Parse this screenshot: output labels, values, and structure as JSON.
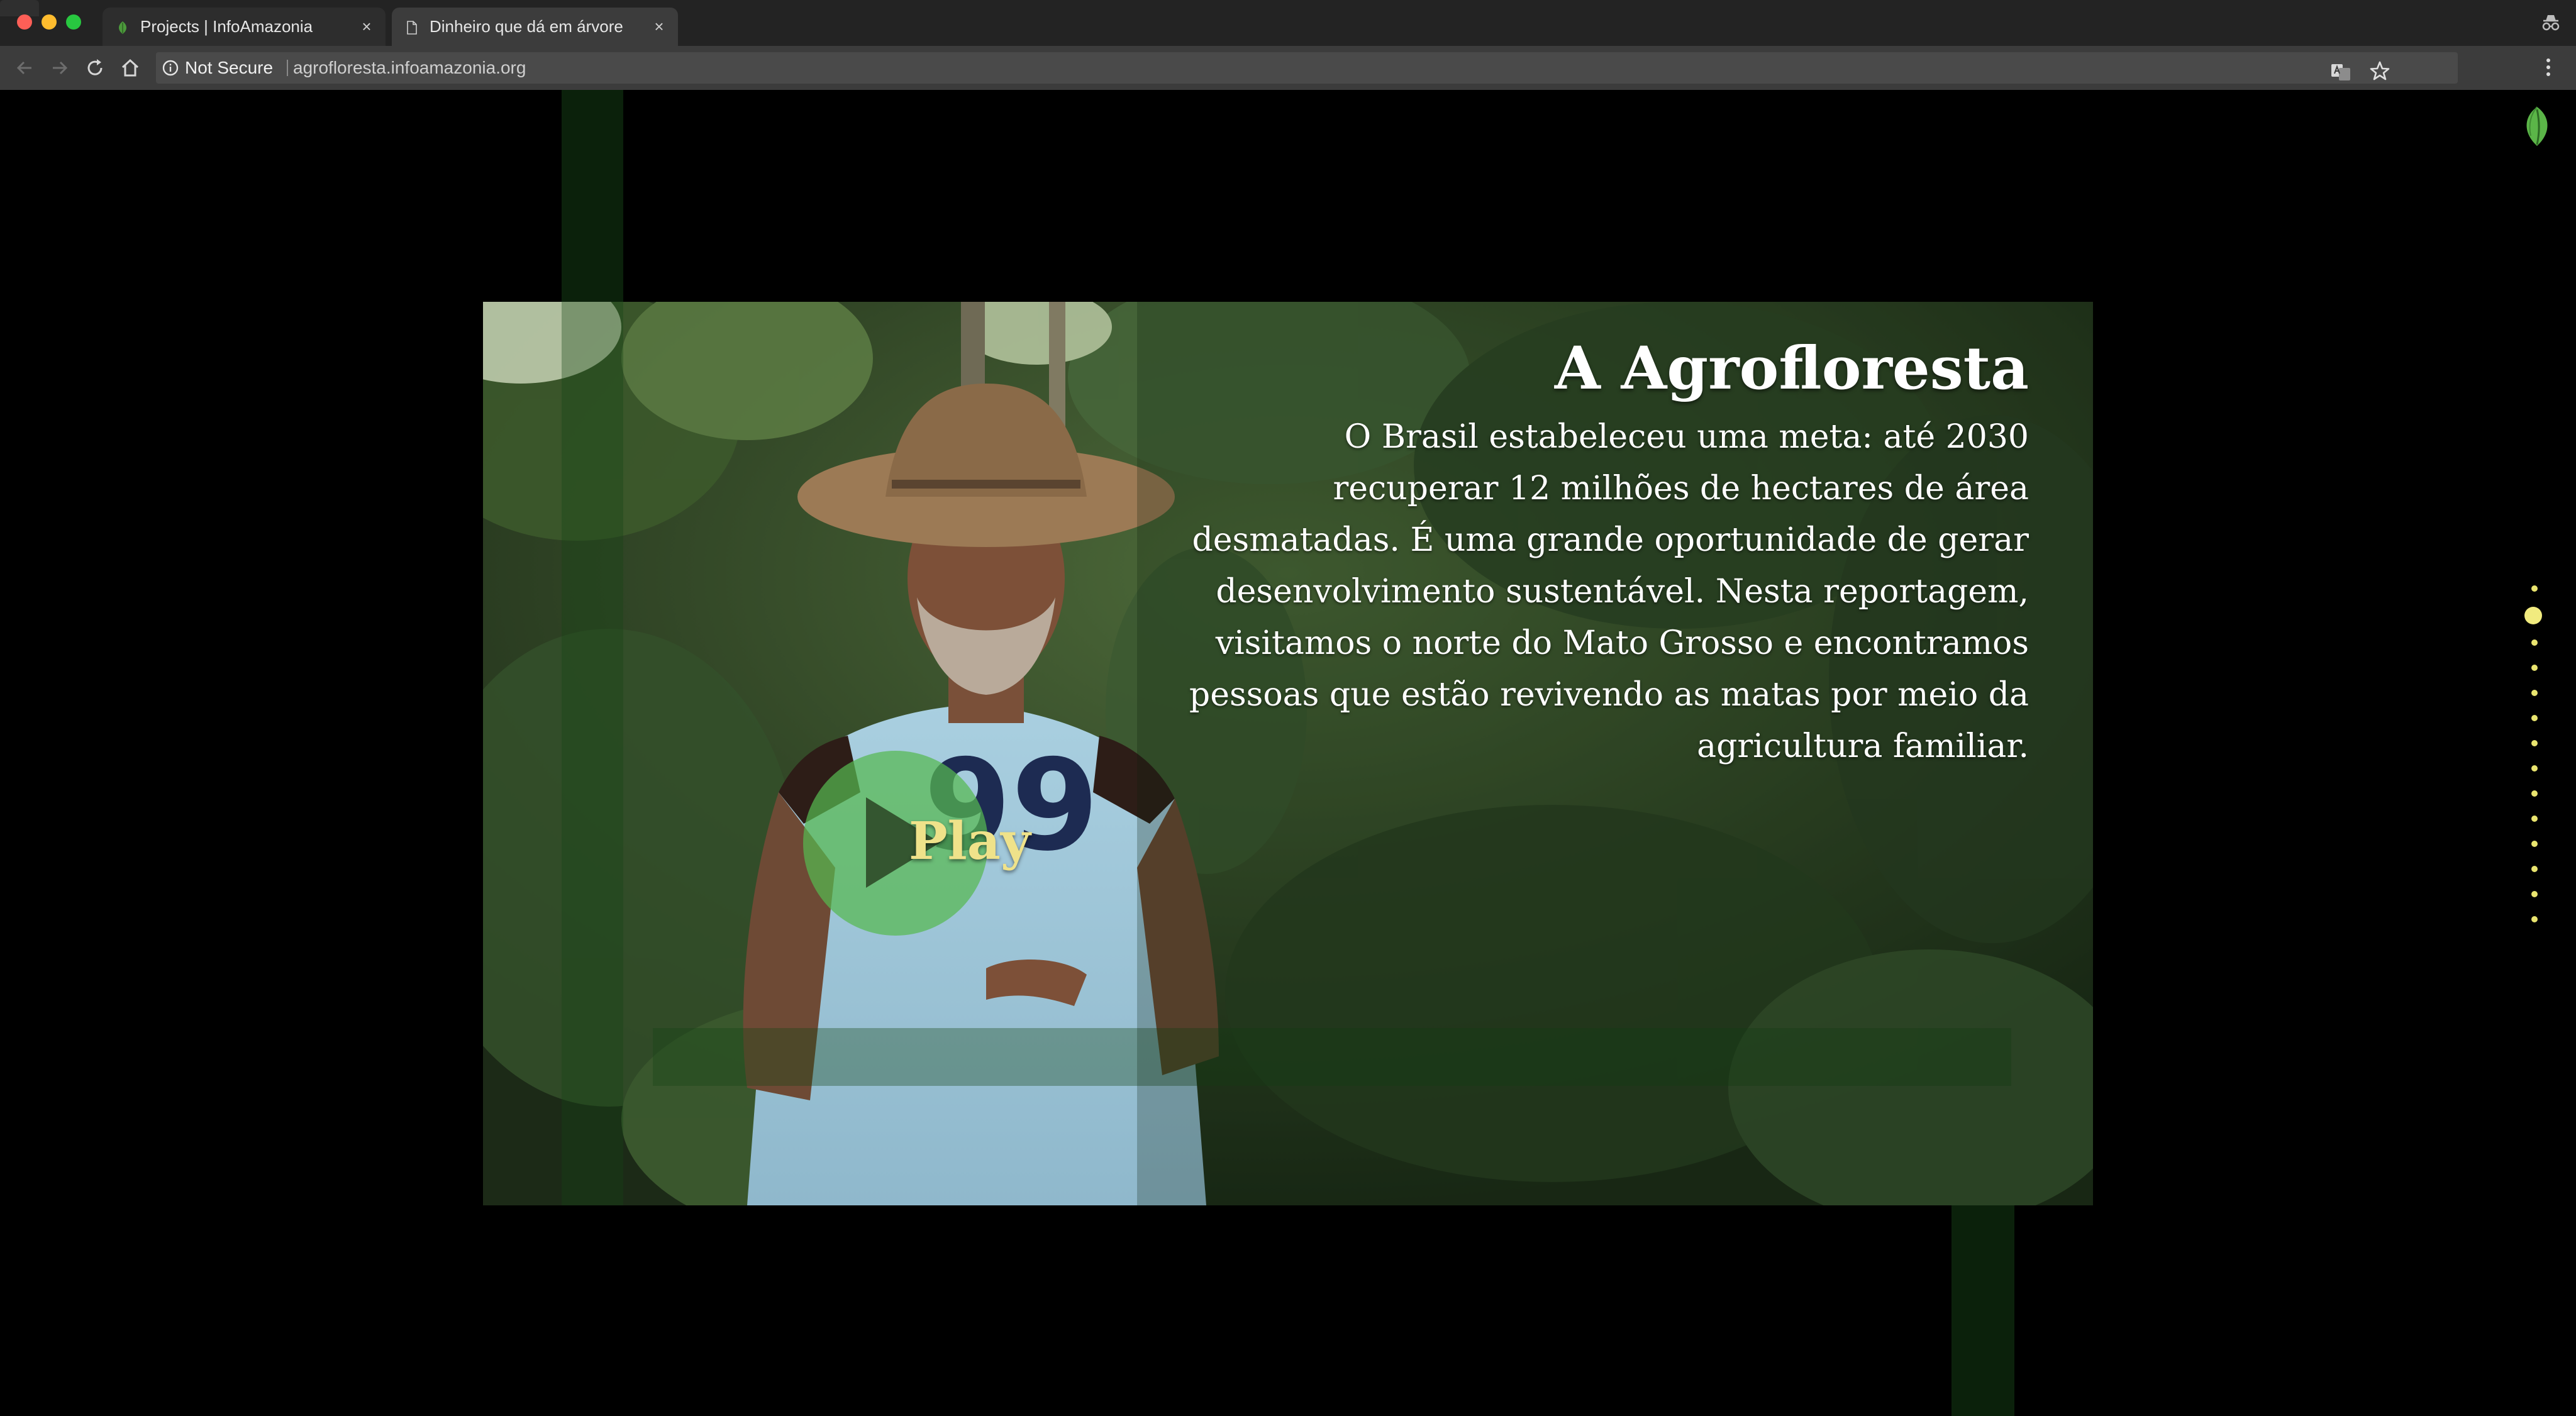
{
  "browser": {
    "tabs": [
      {
        "title": "Projects | InfoAmazonia",
        "icon": "leaf-favicon-icon",
        "active": false
      },
      {
        "title": "Dinheiro que dá em árvore",
        "icon": "page-icon",
        "active": true
      }
    ],
    "tab_close_glyph": "×",
    "security_label": "Not Secure",
    "url": "agrofloresta.infoamazonia.org"
  },
  "hero": {
    "title": "A Agrofloresta",
    "body": "O Brasil estabeleceu uma meta: até 2030 recuperar 12 milhões de hectares de área desmatadas. É uma grande oportunidade de gerar desenvolvimento sustentável. Nesta reportagem, visitamos o norte do Mato Grosso e encontramos pessoas que estão revivendo as matas por meio da agricultura familiar.",
    "play_label": "Play",
    "image_icon": "farmer-in-forest-photo"
  },
  "section_nav": {
    "dot_count": 14,
    "active_index": 1
  },
  "colors": {
    "accent_green": "#56b950",
    "play_text": "#efe28a",
    "nav_dot": "#e9e46f"
  }
}
